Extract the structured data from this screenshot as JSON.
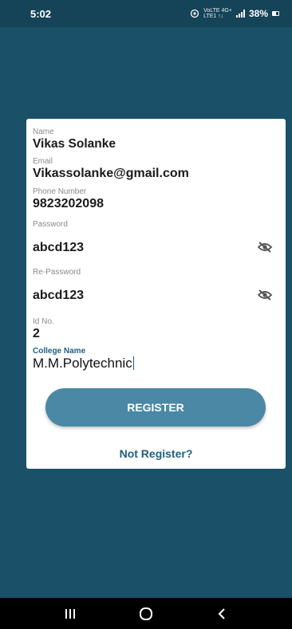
{
  "status_bar": {
    "time": "5:02",
    "network_top": "VoLTE 4G+",
    "network_bottom": "LTE1 ↑↓",
    "battery": "38%"
  },
  "form": {
    "name_label": "Name",
    "name_value": "Vikas Solanke",
    "email_label": "Email",
    "email_value": "Vikassolanke@gmail.com",
    "phone_label": "Phone Number",
    "phone_value": "9823202098",
    "password_label": "Password",
    "password_value": "abcd123",
    "repassword_label": "Re-Password",
    "repassword_value": "abcd123",
    "id_label": "Id No.",
    "id_value": "2",
    "college_label": "College Name",
    "college_value": "M.M.Polytechnic"
  },
  "actions": {
    "register_label": "REGISTER",
    "not_register_label": "Not Register?"
  },
  "icons": {
    "password_toggle": "eye-off-icon",
    "nav_recent": "recent-apps-icon",
    "nav_home": "home-icon",
    "nav_back": "back-icon"
  },
  "colors": {
    "background": "#1a5068",
    "status_bar": "#154358",
    "accent": "#1f5f7e",
    "button": "#4a88a5",
    "card": "#ffffff"
  }
}
